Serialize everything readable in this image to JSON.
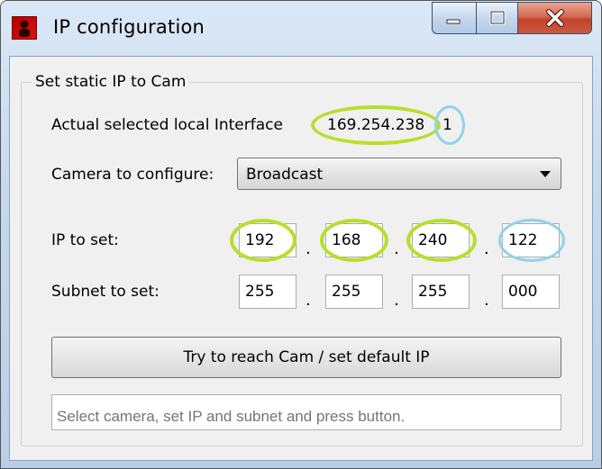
{
  "window": {
    "title": "IP configuration",
    "icon": "camera-app-icon",
    "controls": {
      "minimize": "minimize-icon",
      "maximize": "maximize-icon",
      "close": "close-icon"
    }
  },
  "group": {
    "title": "Set static IP to Cam",
    "interface_label": "Actual selected local Interface",
    "interface_value_main": "169.254.238",
    "interface_value_last": "1",
    "camera_label": "Camera to configure:",
    "camera_value": "Broadcast",
    "ip_label": "IP to set:",
    "ip": [
      "192",
      "168",
      "240",
      "122"
    ],
    "subnet_label": "Subnet to set:",
    "subnet": [
      "255",
      "255",
      "255",
      "000"
    ],
    "separator": "."
  },
  "button": {
    "label": "Try to reach Cam / set default IP"
  },
  "status": {
    "placeholder": "Select camera, set IP and subnet and press button."
  },
  "colors": {
    "annotation_green": "#b7df2b",
    "annotation_blue": "#91d2ea",
    "close_button": "#c0442a"
  }
}
